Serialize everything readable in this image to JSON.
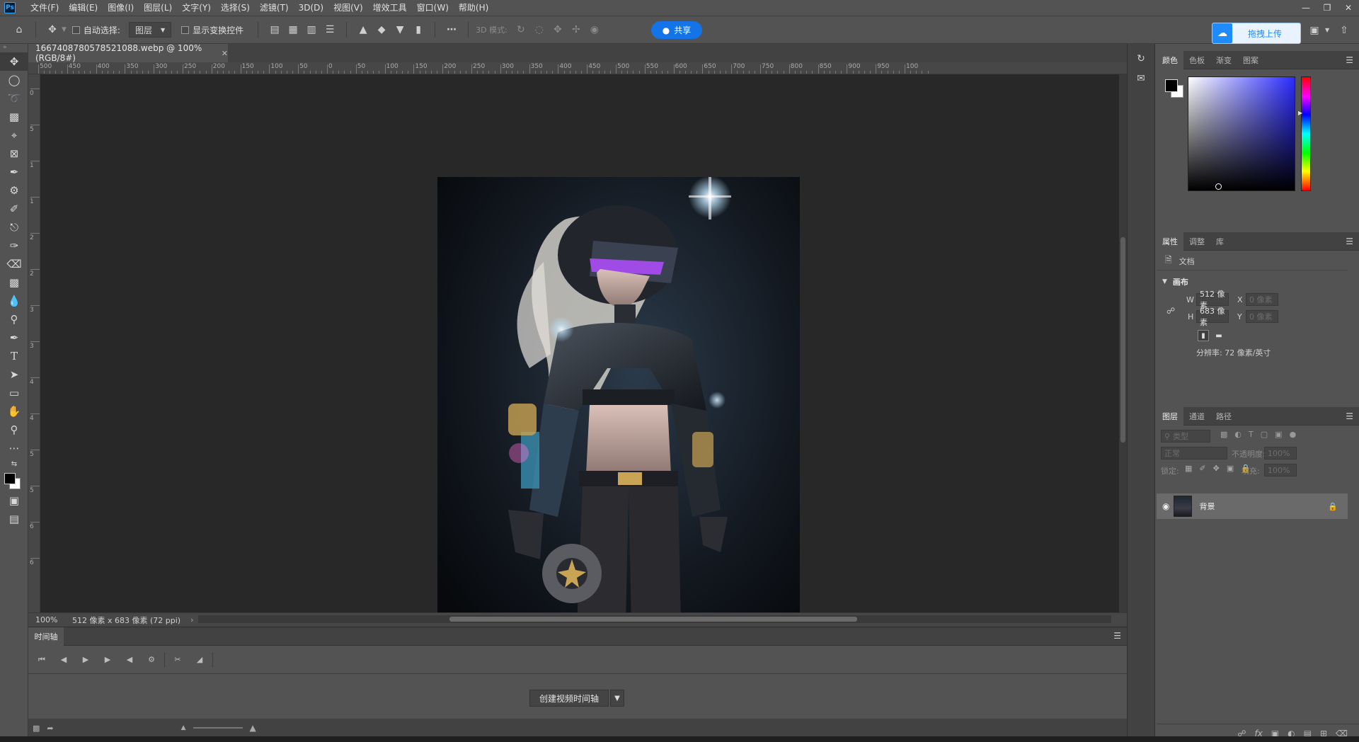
{
  "app": {
    "logo": "Ps"
  },
  "menu": [
    "文件(F)",
    "编辑(E)",
    "图像(I)",
    "图层(L)",
    "文字(Y)",
    "选择(S)",
    "滤镜(T)",
    "3D(D)",
    "视图(V)",
    "增效工具",
    "窗口(W)",
    "帮助(H)"
  ],
  "options": {
    "auto_select_label": "自动选择:",
    "auto_select_target": "图层",
    "show_transform_label": "显示变换控件",
    "mode_3d_label": "3D 模式:",
    "share_label": "共享",
    "upload_label": "拖拽上传"
  },
  "document": {
    "tab_title": "1667408780578521088.webp @ 100%(RGB/8#)",
    "zoom": "100%",
    "info": "512 像素 x 683 像素 (72 ppi)"
  },
  "ruler": {
    "top_labels": [
      "500",
      "450",
      "400",
      "350",
      "300",
      "250",
      "200",
      "150",
      "100",
      "50",
      "0",
      "50",
      "100",
      "150",
      "200",
      "250",
      "300",
      "350",
      "400",
      "450",
      "500",
      "550",
      "600",
      "650",
      "700",
      "750",
      "800",
      "850",
      "900",
      "950",
      "100"
    ],
    "left_labels": [
      "0",
      "5",
      "1",
      "1",
      "2",
      "2",
      "3",
      "3",
      "4",
      "4",
      "5",
      "5",
      "6",
      "6"
    ]
  },
  "timeline": {
    "tab_label": "时间轴",
    "create_label": "创建视频时间轴"
  },
  "color_panel": {
    "tabs": [
      "颜色",
      "色板",
      "渐变",
      "图案"
    ],
    "fg_color": "#000000",
    "bg_color": "#ffffff"
  },
  "properties_panel": {
    "tabs": [
      "属性",
      "调整",
      "库"
    ],
    "doc_label": "文档",
    "section_label": "画布",
    "w_label": "W",
    "w_value": "512 像素",
    "h_label": "H",
    "h_value": "683 像素",
    "x_label": "X",
    "x_placeholder": "0 像素",
    "y_label": "Y",
    "y_placeholder": "0 像素",
    "resolution": "分辨率: 72 像素/英寸"
  },
  "layers_panel": {
    "tabs": [
      "图层",
      "通道",
      "路径"
    ],
    "filter_placeholder": "类型",
    "blend_mode": "正常",
    "opacity_label": "不透明度:",
    "opacity_value": "100%",
    "lock_label": "锁定:",
    "fill_label": "填充:",
    "fill_value": "100%",
    "layer_name": "背景"
  }
}
